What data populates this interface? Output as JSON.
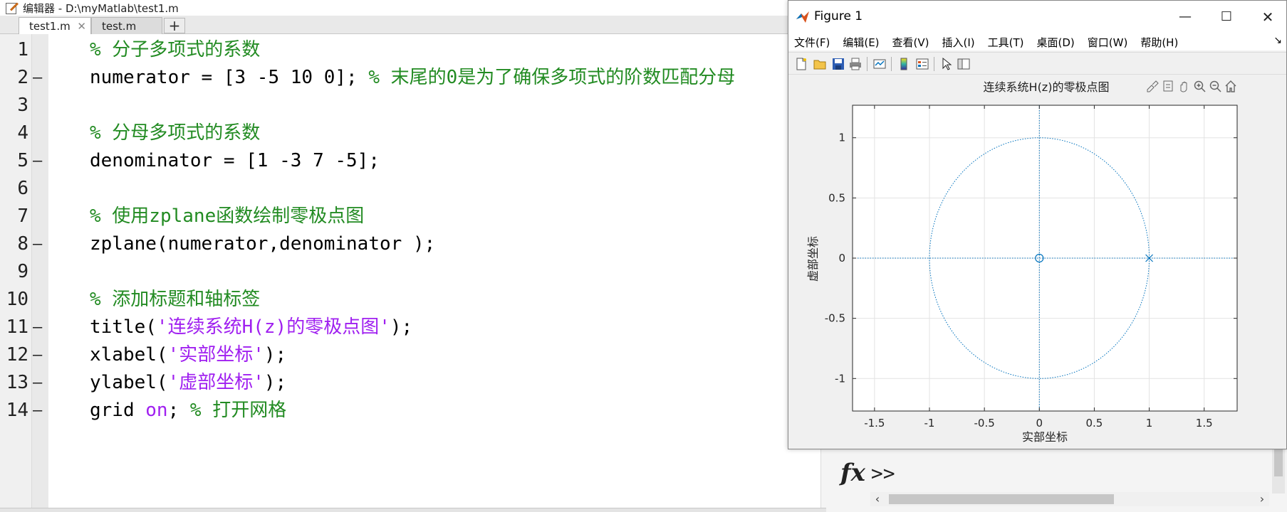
{
  "editor": {
    "title": "编辑器 - D:\\myMatlab\\test1.m",
    "tabs": [
      {
        "label": "test1.m",
        "active": true
      },
      {
        "label": "test.m",
        "active": false
      }
    ],
    "tab_close": "✕",
    "tab_add": "+",
    "dash": "—",
    "lines": [
      {
        "num": "1",
        "dash": false,
        "parts": [
          {
            "t": "% 分子多项式的系数",
            "c": "comment"
          }
        ]
      },
      {
        "num": "2",
        "dash": true,
        "parts": [
          {
            "t": "numerator = [3 -5 10 0]; ",
            "c": "code"
          },
          {
            "t": "% 末尾的0是为了确保多项式的阶数匹配分母",
            "c": "comment"
          }
        ]
      },
      {
        "num": "3",
        "dash": false,
        "parts": []
      },
      {
        "num": "4",
        "dash": false,
        "parts": [
          {
            "t": "% 分母多项式的系数",
            "c": "comment"
          }
        ]
      },
      {
        "num": "5",
        "dash": true,
        "parts": [
          {
            "t": "denominator = [1 -3 7 -5];",
            "c": "code"
          }
        ]
      },
      {
        "num": "6",
        "dash": false,
        "parts": []
      },
      {
        "num": "7",
        "dash": false,
        "parts": [
          {
            "t": "% 使用zplane函数绘制零极点图",
            "c": "comment"
          }
        ]
      },
      {
        "num": "8",
        "dash": true,
        "parts": [
          {
            "t": "zplane(numerator,denominator );",
            "c": "code"
          }
        ]
      },
      {
        "num": "9",
        "dash": false,
        "parts": []
      },
      {
        "num": "10",
        "dash": false,
        "parts": [
          {
            "t": "% 添加标题和轴标签",
            "c": "comment"
          }
        ]
      },
      {
        "num": "11",
        "dash": true,
        "parts": [
          {
            "t": "title(",
            "c": "code"
          },
          {
            "t": "'连续系统H(z)的零极点图'",
            "c": "string"
          },
          {
            "t": ");",
            "c": "code"
          }
        ]
      },
      {
        "num": "12",
        "dash": true,
        "parts": [
          {
            "t": "xlabel(",
            "c": "code"
          },
          {
            "t": "'实部坐标'",
            "c": "string"
          },
          {
            "t": ");",
            "c": "code"
          }
        ]
      },
      {
        "num": "13",
        "dash": true,
        "parts": [
          {
            "t": "ylabel(",
            "c": "code"
          },
          {
            "t": "'虚部坐标'",
            "c": "string"
          },
          {
            "t": ");",
            "c": "code"
          }
        ]
      },
      {
        "num": "14",
        "dash": true,
        "parts": [
          {
            "t": "grid ",
            "c": "code"
          },
          {
            "t": "on",
            "c": "keyword"
          },
          {
            "t": "; ",
            "c": "code"
          },
          {
            "t": "% 打开网格",
            "c": "comment"
          }
        ]
      }
    ]
  },
  "command_window": {
    "prompt": ">>",
    "fx": "fx",
    "scroll_left": "‹",
    "scroll_right": "›"
  },
  "figure": {
    "title": "Figure 1",
    "window_buttons": {
      "minimize": "—",
      "maximize": "☐",
      "close": "✕"
    },
    "menus": [
      "文件(F)",
      "编辑(E)",
      "查看(V)",
      "插入(I)",
      "工具(T)",
      "桌面(D)",
      "窗口(W)",
      "帮助(H)"
    ],
    "menu_overflow": "↘",
    "toolbar_icons": [
      "new-figure-icon",
      "open-file-icon",
      "save-icon",
      "print-icon",
      "link-plot-icon",
      "colorbar-icon",
      "legend-icon",
      "pointer-icon",
      "property-inspector-icon"
    ],
    "axes_toolbar_icons": [
      "brush-icon",
      "datatip-icon",
      "pan-icon",
      "zoom-in-icon",
      "zoom-out-icon",
      "home-icon"
    ]
  },
  "colors": {
    "comment": "#228b22",
    "string": "#a020f0",
    "keyword": "#a020f0",
    "plot": "#0072bd"
  },
  "chart_data": {
    "type": "scatter",
    "title": "连续系统H(z)的零极点图",
    "xlabel": "实部坐标",
    "ylabel": "虚部坐标",
    "xlim": [
      -1.7,
      1.8
    ],
    "ylim": [
      -1.27,
      1.27
    ],
    "xticks": [
      -1.5,
      -1,
      -0.5,
      0,
      0.5,
      1,
      1.5
    ],
    "xtick_labels": [
      "-1.5",
      "-1",
      "-0.5",
      "0",
      "0.5",
      "1",
      "1.5"
    ],
    "yticks": [
      -1,
      -0.5,
      0,
      0.5,
      1
    ],
    "ytick_labels": [
      "-1",
      "-0.5",
      "0",
      "0.5",
      "1"
    ],
    "grid": true,
    "unit_circle": {
      "center": [
        0,
        0
      ],
      "radius": 1,
      "style": "dotted"
    },
    "series": [
      {
        "marker": "o",
        "points": [
          [
            0,
            0
          ]
        ]
      },
      {
        "marker": "x",
        "points": [
          [
            1,
            0
          ]
        ]
      }
    ]
  }
}
